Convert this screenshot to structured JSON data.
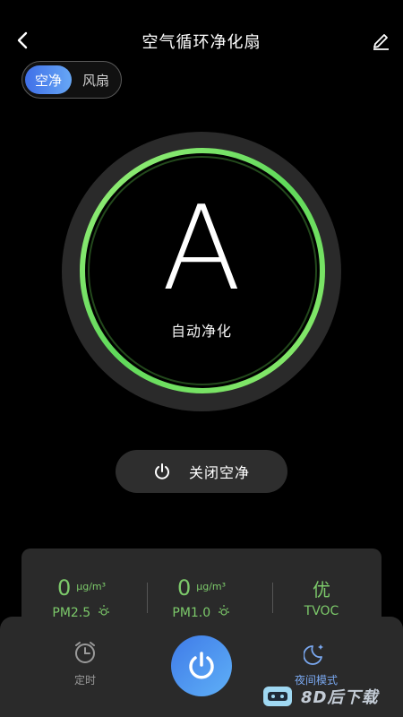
{
  "header": {
    "title": "空气循环净化扇",
    "back_icon": "chevron-left-icon",
    "edit_icon": "pencil-icon"
  },
  "mode_switch": {
    "options": [
      "空净",
      "风扇"
    ],
    "selected": "空净",
    "accent_color": "#4f8ef0"
  },
  "dial": {
    "mode_letter": "A",
    "mode_label": "自动净化",
    "ring_color": "#6fe36a"
  },
  "power_toggle": {
    "label": "关闭空净",
    "icon": "power-icon"
  },
  "metrics": [
    {
      "value": "0",
      "unit": "μg/m³",
      "name": "PM2.5"
    },
    {
      "value": "0",
      "unit": "μg/m³",
      "name": "PM1.0"
    },
    {
      "value": "优",
      "unit": "",
      "name": "TVOC"
    }
  ],
  "bottom_nav": {
    "timer_label": "定时",
    "night_label": "夜间模式",
    "power_icon": "power-icon"
  },
  "watermark": {
    "text": "8D后下载"
  }
}
